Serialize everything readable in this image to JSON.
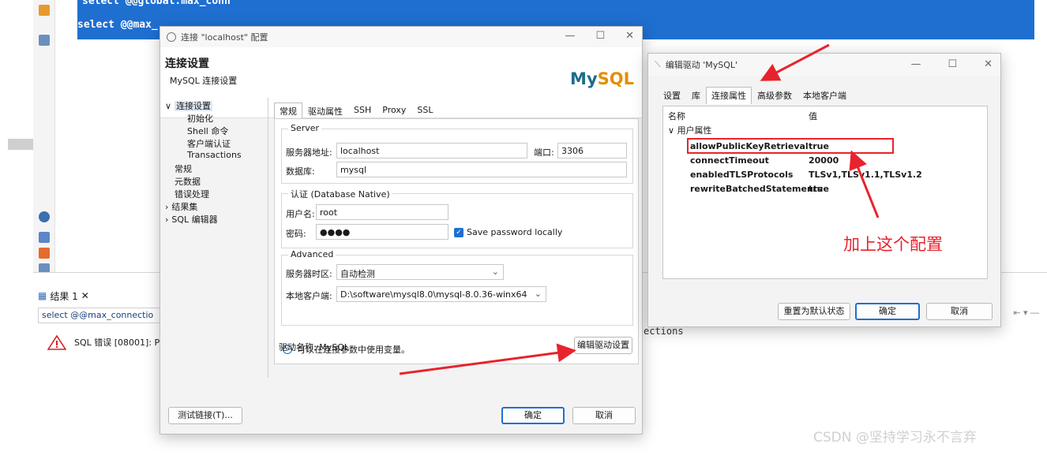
{
  "ide": {
    "code_line1": "select @@global.max_conn",
    "code_line2": "select @@max_",
    "results_tab": "结果 1",
    "results_query": "select @@max_connectio",
    "sql_error": "SQL 错误 [08001]: Pu",
    "connections_fragment": "ections"
  },
  "conn_dialog": {
    "title": "连接 \"localhost\" 配置",
    "header_title": "连接设置",
    "header_subtitle": "MySQL 连接设置",
    "logo_my": "My",
    "logo_sql": "SQL",
    "tree": [
      {
        "label": "连接设置",
        "prefix": "∨",
        "indent": 0,
        "selected": true
      },
      {
        "label": "初始化",
        "prefix": "",
        "indent": 1
      },
      {
        "label": "Shell 命令",
        "prefix": "",
        "indent": 1
      },
      {
        "label": "客户端认证",
        "prefix": "",
        "indent": 1
      },
      {
        "label": "Transactions",
        "prefix": "",
        "indent": 1
      },
      {
        "label": "常规",
        "prefix": "",
        "indent": 0
      },
      {
        "label": "元数据",
        "prefix": "",
        "indent": 0
      },
      {
        "label": "错误处理",
        "prefix": "",
        "indent": 0
      },
      {
        "label": "结果集",
        "prefix": "›",
        "indent": 0
      },
      {
        "label": "SQL 编辑器",
        "prefix": "›",
        "indent": 0
      }
    ],
    "tabs": [
      "常规",
      "驱动属性",
      "SSH",
      "Proxy",
      "SSL"
    ],
    "server_group": "Server",
    "host_label": "服务器地址:",
    "host_value": "localhost",
    "port_label": "端口:",
    "port_value": "3306",
    "database_label": "数据库:",
    "database_value": "mysql",
    "auth_group": "认证 (Database Native)",
    "user_label": "用户名:",
    "user_value": "root",
    "password_label": "密码:",
    "password_value": "●●●●",
    "save_password": "Save password locally",
    "advanced_group": "Advanced",
    "timezone_label": "服务器时区:",
    "timezone_value": "自动检测",
    "client_label": "本地客户端:",
    "client_value": "D:\\software\\mysql8.0\\mysql-8.0.36-winx64",
    "info_text": "可以在连接参数中使用变量。",
    "driver_name_label": "驱动名称:",
    "driver_name_value": "MySQL",
    "edit_driver_button": "编辑驱动设置",
    "test_button": "测试链接(T)...",
    "ok_button": "确定",
    "cancel_button": "取消"
  },
  "driver_dialog": {
    "title": "编辑驱动 'MySQL'",
    "tabs": [
      "设置",
      "库",
      "连接属性",
      "高级参数",
      "本地客户端"
    ],
    "col_name": "名称",
    "col_value": "值",
    "group_label": "用户属性",
    "properties": [
      {
        "name": "allowPublicKeyRetrieval",
        "value": "true"
      },
      {
        "name": "connectTimeout",
        "value": "20000"
      },
      {
        "name": "enabledTLSProtocols",
        "value": "TLSv1,TLSv1.1,TLSv1.2"
      },
      {
        "name": "rewriteBatchedStatements",
        "value": "true"
      }
    ],
    "reset_button": "重置为默认状态",
    "ok_button": "确定",
    "cancel_button": "取消"
  },
  "annotation": "加上这个配置",
  "watermark": "CSDN @坚持学习永不言弃",
  "colors": {
    "accent": "#1f6fd1",
    "annotation_red": "#e8232d",
    "mysql_blue": "#1d6c8c",
    "mysql_orange": "#e48e00"
  }
}
